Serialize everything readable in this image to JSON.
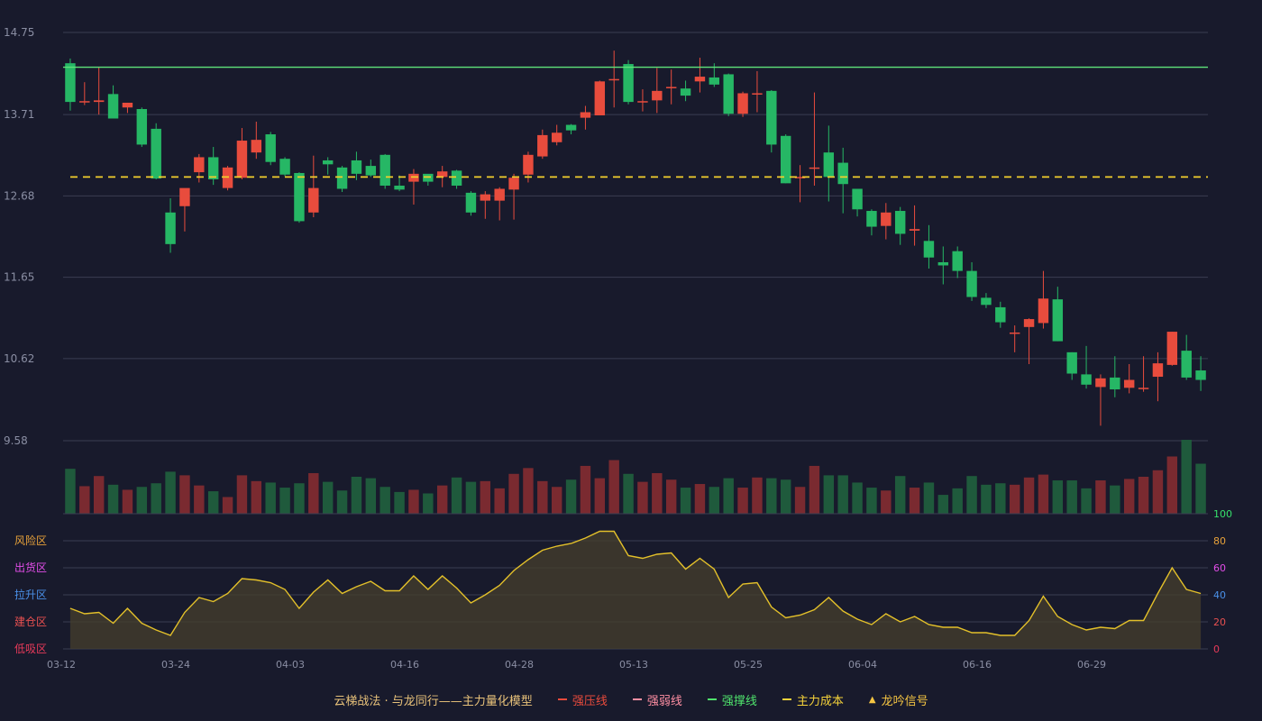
{
  "legend": {
    "title": "云梯战法 · 与龙同行——主力量化模型",
    "items": [
      {
        "label": "强压线",
        "color": "#e94b3c",
        "style": "solid"
      },
      {
        "label": "强弱线",
        "color": "#ff8fa3",
        "style": "dashed"
      },
      {
        "label": "强撑线",
        "color": "#4fe36c",
        "style": "solid"
      },
      {
        "label": "主力成本",
        "color": "#f5d23a",
        "style": "dashed"
      },
      {
        "label": "龙吟信号",
        "color": "#f5c542",
        "style": "triangle",
        "icon": "triangle-up-icon"
      }
    ]
  },
  "chart_data": {
    "type": "candlestick",
    "price_axis": {
      "ticks": [
        "14.75",
        "13.71",
        "12.68",
        "11.65",
        "10.62",
        "9.58"
      ],
      "ylim": [
        9.58,
        14.75
      ]
    },
    "x_ticks": [
      {
        "label": "03-12",
        "index": 0
      },
      {
        "label": "03-24",
        "index": 8
      },
      {
        "label": "04-03",
        "index": 16
      },
      {
        "label": "04-16",
        "index": 24
      },
      {
        "label": "04-28",
        "index": 32
      },
      {
        "label": "05-13",
        "index": 40
      },
      {
        "label": "05-25",
        "index": 48
      },
      {
        "label": "06-04",
        "index": 56
      },
      {
        "label": "06-16",
        "index": 64
      },
      {
        "label": "06-29",
        "index": 72
      }
    ],
    "support_line": 14.31,
    "main_cost": 12.92,
    "candles": [
      [
        14.36,
        13.87,
        14.42,
        13.76
      ],
      [
        13.88,
        13.88,
        14.12,
        13.83
      ],
      [
        13.87,
        13.89,
        14.31,
        13.71
      ],
      [
        13.97,
        13.66,
        14.08,
        13.66
      ],
      [
        13.8,
        13.86,
        13.86,
        13.73
      ],
      [
        13.78,
        13.33,
        13.8,
        13.3
      ],
      [
        13.53,
        12.9,
        13.6,
        12.89
      ],
      [
        12.47,
        12.07,
        12.65,
        11.96
      ],
      [
        12.55,
        12.78,
        12.75,
        12.23
      ],
      [
        12.98,
        13.17,
        13.21,
        12.85
      ],
      [
        13.17,
        12.89,
        13.3,
        12.82
      ],
      [
        12.78,
        13.04,
        13.06,
        12.75
      ],
      [
        12.91,
        13.38,
        13.54,
        12.89
      ],
      [
        13.23,
        13.39,
        13.62,
        13.15
      ],
      [
        13.46,
        13.11,
        13.49,
        13.07
      ],
      [
        13.15,
        12.95,
        13.17,
        12.93
      ],
      [
        12.97,
        12.36,
        12.98,
        12.34
      ],
      [
        12.47,
        12.78,
        13.19,
        12.41
      ],
      [
        13.13,
        13.08,
        13.17,
        12.95
      ],
      [
        13.04,
        12.77,
        13.06,
        12.73
      ],
      [
        13.13,
        12.96,
        13.24,
        12.88
      ],
      [
        13.06,
        12.94,
        13.14,
        12.92
      ],
      [
        13.2,
        12.81,
        13.21,
        12.77
      ],
      [
        12.81,
        12.76,
        12.94,
        12.74
      ],
      [
        12.86,
        12.96,
        13.02,
        12.57
      ],
      [
        12.96,
        12.86,
        12.95,
        12.81
      ],
      [
        12.92,
        12.99,
        13.06,
        12.79
      ],
      [
        13.0,
        12.81,
        13.01,
        12.77
      ],
      [
        12.72,
        12.47,
        12.74,
        12.43
      ],
      [
        12.62,
        12.7,
        12.74,
        12.39
      ],
      [
        12.62,
        12.77,
        12.79,
        12.37
      ],
      [
        12.76,
        12.91,
        12.96,
        12.38
      ],
      [
        12.95,
        13.2,
        13.24,
        12.85
      ],
      [
        13.18,
        13.45,
        13.52,
        13.15
      ],
      [
        13.36,
        13.48,
        13.58,
        13.32
      ],
      [
        13.58,
        13.51,
        13.59,
        13.46
      ],
      [
        13.67,
        13.74,
        13.82,
        13.52
      ],
      [
        13.7,
        14.13,
        14.14,
        13.7
      ],
      [
        14.16,
        14.16,
        14.52,
        13.8
      ],
      [
        14.35,
        13.87,
        14.4,
        13.84
      ],
      [
        13.88,
        13.88,
        14.03,
        13.75
      ],
      [
        13.89,
        14.01,
        14.3,
        13.73
      ],
      [
        14.06,
        14.06,
        14.28,
        13.84
      ],
      [
        14.04,
        13.95,
        14.14,
        13.88
      ],
      [
        14.13,
        14.19,
        14.43,
        13.99
      ],
      [
        14.18,
        14.09,
        14.36,
        14.06
      ],
      [
        14.22,
        13.72,
        14.23,
        13.69
      ],
      [
        13.72,
        13.98,
        14.0,
        13.68
      ],
      [
        13.98,
        13.98,
        14.26,
        13.74
      ],
      [
        14.01,
        13.33,
        14.02,
        13.23
      ],
      [
        13.44,
        12.84,
        13.46,
        12.84
      ],
      [
        12.92,
        12.92,
        13.07,
        12.6
      ],
      [
        13.04,
        13.04,
        13.99,
        12.81
      ],
      [
        13.23,
        12.92,
        13.57,
        12.61
      ],
      [
        13.1,
        12.83,
        13.29,
        12.46
      ],
      [
        12.77,
        12.51,
        12.77,
        12.42
      ],
      [
        12.49,
        12.29,
        12.51,
        12.18
      ],
      [
        12.3,
        12.47,
        12.59,
        12.13
      ],
      [
        12.49,
        12.2,
        12.54,
        12.06
      ],
      [
        12.24,
        12.26,
        12.56,
        12.05
      ],
      [
        12.11,
        11.9,
        12.31,
        11.76
      ],
      [
        11.84,
        11.8,
        12.04,
        11.56
      ],
      [
        11.98,
        11.73,
        12.04,
        11.64
      ],
      [
        11.73,
        11.4,
        11.84,
        11.35
      ],
      [
        11.39,
        11.3,
        11.45,
        11.26
      ],
      [
        11.27,
        11.08,
        11.34,
        11.01
      ],
      [
        10.95,
        10.95,
        11.04,
        10.7
      ],
      [
        11.02,
        11.12,
        11.13,
        10.55
      ],
      [
        11.07,
        11.38,
        11.73,
        11.0
      ],
      [
        11.37,
        10.84,
        11.53,
        10.84
      ],
      [
        10.7,
        10.43,
        10.7,
        10.35
      ],
      [
        10.42,
        10.29,
        10.78,
        10.24
      ],
      [
        10.26,
        10.37,
        10.42,
        9.77
      ],
      [
        10.38,
        10.23,
        10.65,
        10.13
      ],
      [
        10.25,
        10.35,
        10.55,
        10.18
      ],
      [
        10.25,
        10.25,
        10.65,
        10.2
      ],
      [
        10.39,
        10.56,
        10.7,
        10.08
      ],
      [
        10.54,
        10.96,
        10.96,
        10.53
      ],
      [
        10.72,
        10.38,
        10.92,
        10.35
      ],
      [
        10.47,
        10.35,
        10.65,
        10.21
      ]
    ],
    "volume": [
      0.62,
      0.38,
      0.52,
      0.4,
      0.33,
      0.37,
      0.42,
      0.58,
      0.53,
      0.39,
      0.31,
      0.23,
      0.53,
      0.45,
      0.43,
      0.36,
      0.42,
      0.56,
      0.44,
      0.32,
      0.51,
      0.49,
      0.37,
      0.3,
      0.33,
      0.28,
      0.39,
      0.5,
      0.44,
      0.45,
      0.35,
      0.55,
      0.63,
      0.45,
      0.37,
      0.47,
      0.66,
      0.49,
      0.74,
      0.55,
      0.44,
      0.56,
      0.47,
      0.36,
      0.41,
      0.37,
      0.49,
      0.36,
      0.5,
      0.49,
      0.47,
      0.37,
      0.66,
      0.53,
      0.53,
      0.43,
      0.36,
      0.32,
      0.52,
      0.36,
      0.43,
      0.26,
      0.35,
      0.52,
      0.4,
      0.42,
      0.4,
      0.5,
      0.54,
      0.46,
      0.46,
      0.35,
      0.46,
      0.39,
      0.48,
      0.51,
      0.6,
      0.79,
      1.02,
      0.69
    ],
    "volume_colors": [
      "#7a2a30",
      "#1f5a3c"
    ],
    "oscillator": {
      "zones": [
        {
          "label": "风险区",
          "color": "#e8a23a"
        },
        {
          "label": "出货区",
          "color": "#e24de8"
        },
        {
          "label": "拉升区",
          "color": "#4a90e8"
        },
        {
          "label": "建仓区",
          "color": "#e85050"
        },
        {
          "label": "低吸区",
          "color": "#e83a5a"
        }
      ],
      "y_ticks": [
        {
          "label": "100",
          "color": "#36e06b"
        },
        {
          "label": "80",
          "color": "#e8a23a"
        },
        {
          "label": "60",
          "color": "#e24de8"
        },
        {
          "label": "40",
          "color": "#4a90e8"
        },
        {
          "label": "20",
          "color": "#e85050"
        },
        {
          "label": "0",
          "color": "#e83a5a"
        }
      ],
      "ylim": [
        0,
        100
      ],
      "values": [
        30,
        26,
        27,
        19,
        30,
        19,
        14,
        10,
        27,
        38,
        35,
        41,
        52,
        51,
        49,
        44,
        30,
        42,
        51,
        41,
        46,
        50,
        43,
        43,
        54,
        44,
        54,
        45,
        34,
        40,
        47,
        58,
        66,
        73,
        76,
        78,
        82,
        87,
        87,
        69,
        67,
        70,
        71,
        59,
        67,
        59,
        38,
        48,
        49,
        31,
        23,
        25,
        29,
        38,
        28,
        22,
        18,
        26,
        20,
        24,
        18,
        16,
        16,
        12,
        12,
        10,
        10,
        21,
        39,
        24,
        18,
        14,
        16,
        15,
        21,
        21,
        41,
        60,
        44,
        41
      ]
    }
  }
}
